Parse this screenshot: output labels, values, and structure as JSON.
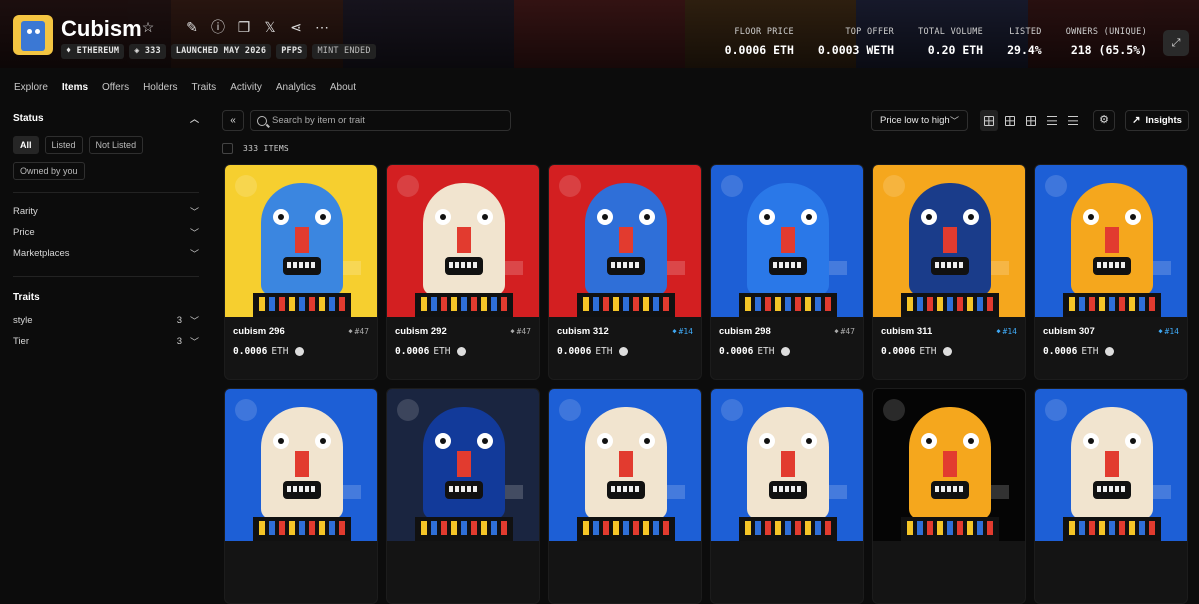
{
  "header": {
    "title": "Cubism",
    "badges": [
      "ETHEREUM",
      "333",
      "LAUNCHED MAY 2026",
      "PFPS",
      "MINT ENDED"
    ],
    "stats": [
      {
        "label": "FLOOR PRICE",
        "value": "0.0006 ETH"
      },
      {
        "label": "TOP OFFER",
        "value": "0.0003 WETH"
      },
      {
        "label": "TOTAL VOLUME",
        "value": "0.20 ETH"
      },
      {
        "label": "LISTED",
        "value": "29.4%"
      },
      {
        "label": "OWNERS (UNIQUE)",
        "value": "218 (65.5%)"
      }
    ]
  },
  "tabs": [
    "Explore",
    "Items",
    "Offers",
    "Holders",
    "Traits",
    "Activity",
    "Analytics",
    "About"
  ],
  "active_tab": "Items",
  "sidebar": {
    "status_title": "Status",
    "status_filters": [
      "All",
      "Listed",
      "Not Listed"
    ],
    "owned_filter": "Owned by you",
    "filters": [
      "Rarity",
      "Price",
      "Marketplaces"
    ],
    "traits_title": "Traits",
    "traits": [
      {
        "name": "style",
        "count": "3"
      },
      {
        "name": "Tier",
        "count": "3"
      }
    ]
  },
  "toolbar": {
    "search_placeholder": "Search by item or trait",
    "sort_label": "Price low to high",
    "insights_label": "Insights"
  },
  "items_count": "333 ITEMS",
  "cards": [
    {
      "name": "cubism 296",
      "rank": "#47",
      "price": "0.0006",
      "unit": "ETH",
      "bg": "#f6cf2f",
      "face": "#3b86e0",
      "rank_color": "#aaaaaa"
    },
    {
      "name": "cubism 292",
      "rank": "#47",
      "price": "0.0006",
      "unit": "ETH",
      "bg": "#d31f21",
      "face": "#f1e4cf",
      "rank_color": "#aaaaaa"
    },
    {
      "name": "cubism 312",
      "rank": "#14",
      "price": "0.0006",
      "unit": "ETH",
      "bg": "#d31f21",
      "face": "#2f6fd8",
      "rank_color": "#3fa9f5"
    },
    {
      "name": "cubism 298",
      "rank": "#47",
      "price": "0.0006",
      "unit": "ETH",
      "bg": "#1d5fd6",
      "face": "#2a78e8",
      "rank_color": "#aaaaaa"
    },
    {
      "name": "cubism 311",
      "rank": "#14",
      "price": "0.0006",
      "unit": "ETH",
      "bg": "#f5a71d",
      "face": "#1a3c8a",
      "rank_color": "#3fa9f5"
    },
    {
      "name": "cubism 307",
      "rank": "#14",
      "price": "0.0006",
      "unit": "ETH",
      "bg": "#1d5fd6",
      "face": "#f5a71d",
      "rank_color": "#3fa9f5"
    },
    {
      "name": "",
      "rank": "",
      "price": "",
      "unit": "",
      "bg": "#1d5fd6",
      "face": "#f1e4cf",
      "rank_color": "#aaaaaa"
    },
    {
      "name": "",
      "rank": "",
      "price": "",
      "unit": "",
      "bg": "#1a2540",
      "face": "#123a9a",
      "rank_color": "#aaaaaa"
    },
    {
      "name": "",
      "rank": "",
      "price": "",
      "unit": "",
      "bg": "#1d5fd6",
      "face": "#f1e4cf",
      "rank_color": "#aaaaaa"
    },
    {
      "name": "",
      "rank": "",
      "price": "",
      "unit": "",
      "bg": "#1d5fd6",
      "face": "#f1e4cf",
      "rank_color": "#aaaaaa"
    },
    {
      "name": "",
      "rank": "",
      "price": "",
      "unit": "",
      "bg": "#050505",
      "face": "#f5a71d",
      "rank_color": "#aaaaaa"
    },
    {
      "name": "",
      "rank": "",
      "price": "",
      "unit": "",
      "bg": "#1d5fd6",
      "face": "#f1e4cf",
      "rank_color": "#aaaaaa"
    }
  ],
  "colors": {
    "accent_blue": "#3fa9f5",
    "background": "#0c0c0c"
  }
}
